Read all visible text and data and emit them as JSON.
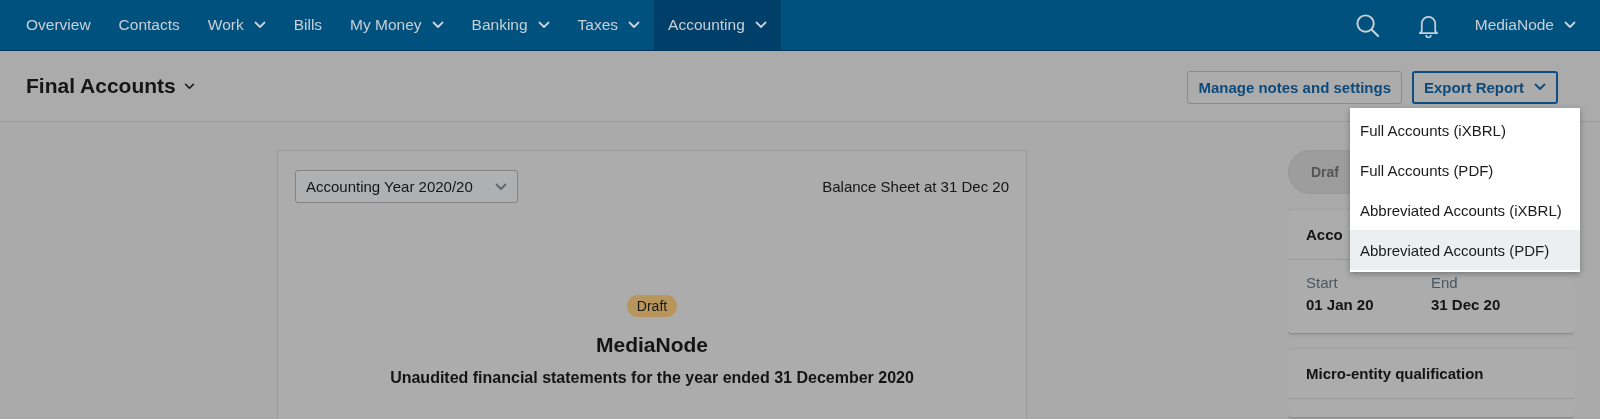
{
  "nav": {
    "items": [
      {
        "label": "Overview",
        "caret": false,
        "selected": false
      },
      {
        "label": "Contacts",
        "caret": false,
        "selected": false
      },
      {
        "label": "Work",
        "caret": true,
        "selected": false
      },
      {
        "label": "Bills",
        "caret": false,
        "selected": false
      },
      {
        "label": "My Money",
        "caret": true,
        "selected": false
      },
      {
        "label": "Banking",
        "caret": true,
        "selected": false
      },
      {
        "label": "Taxes",
        "caret": true,
        "selected": false
      },
      {
        "label": "Accounting",
        "caret": true,
        "selected": true
      }
    ],
    "user": "MediaNode"
  },
  "header": {
    "title": "Final Accounts",
    "buttons": [
      {
        "label": "Manage notes and settings",
        "kind": "secondary",
        "caret": false
      },
      {
        "label": "Export Report",
        "kind": "primary",
        "caret": true
      }
    ]
  },
  "export_menu": {
    "items": [
      {
        "label": "Full Accounts (iXBRL)",
        "hovered": false
      },
      {
        "label": "Full Accounts (PDF)",
        "hovered": false
      },
      {
        "label": "Abbreviated Accounts (iXBRL)",
        "hovered": false
      },
      {
        "label": "Abbreviated Accounts (PDF)",
        "hovered": true
      }
    ]
  },
  "report": {
    "year_select": "Accounting Year 2020/20",
    "balance_sheet_label": "Balance Sheet at 31 Dec 20",
    "status_badge": "Draft",
    "company": "MediaNode",
    "subtitle": "Unaudited financial statements for the year ended 31 December 2020"
  },
  "sidebar": {
    "status_pill": "Draf",
    "period_card": {
      "title": "Acco",
      "start_label": "Start",
      "start": "01 Jan 20",
      "end_label": "End",
      "end": "31 Dec 20"
    },
    "qualification_card": {
      "title": "Micro-entity qualification"
    }
  }
}
